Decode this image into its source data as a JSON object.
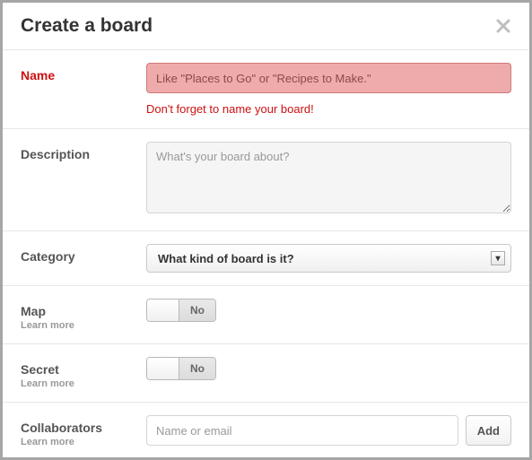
{
  "header": {
    "title": "Create a board"
  },
  "name": {
    "label": "Name",
    "placeholder": "Like \"Places to Go\" or \"Recipes to Make.\"",
    "error": "Don't forget to name your board!"
  },
  "description": {
    "label": "Description",
    "placeholder": "What's your board about?"
  },
  "category": {
    "label": "Category",
    "selected": "What kind of board is it?"
  },
  "map": {
    "label": "Map",
    "learn_more": "Learn more",
    "state": "No"
  },
  "secret": {
    "label": "Secret",
    "learn_more": "Learn more",
    "state": "No"
  },
  "collaborators": {
    "label": "Collaborators",
    "learn_more": "Learn more",
    "placeholder": "Name or email",
    "add_label": "Add"
  }
}
